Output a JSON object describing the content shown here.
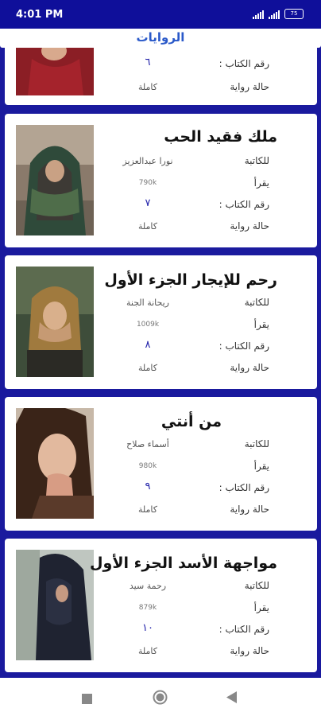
{
  "status": {
    "time": "4:01 PM",
    "battery": "75"
  },
  "appbar": {
    "title": "الروايات"
  },
  "labels": {
    "author": "للكاتبة",
    "reads": "يقرأ",
    "book_number": "رقم الكتاب :",
    "status": "حالة رواية"
  },
  "novels": [
    {
      "title": "",
      "author": "",
      "reads": "",
      "number": "٦",
      "state": "كاملة"
    },
    {
      "title": "ملك فقيد الحب",
      "author": "نورا عبدالعزيز",
      "reads": "790k",
      "number": "٧",
      "state": "كاملة"
    },
    {
      "title": "رحم للإيجار الجزء الأول",
      "author": "ريحانة الجنة",
      "reads": "1009k",
      "number": "٨",
      "state": "كاملة"
    },
    {
      "title": "من أنتي",
      "author": "أسماء صلاح",
      "reads": "980k",
      "number": "٩",
      "state": "كاملة"
    },
    {
      "title": "مواجهة الأسد الجزء الأول",
      "author": "رحمة سيد",
      "reads": "879k",
      "number": "١٠",
      "state": "كاملة"
    }
  ],
  "colors": {
    "accent": "#1a1a9e",
    "status_bar": "#0f0f9a",
    "title_text": "#2a59c9"
  }
}
